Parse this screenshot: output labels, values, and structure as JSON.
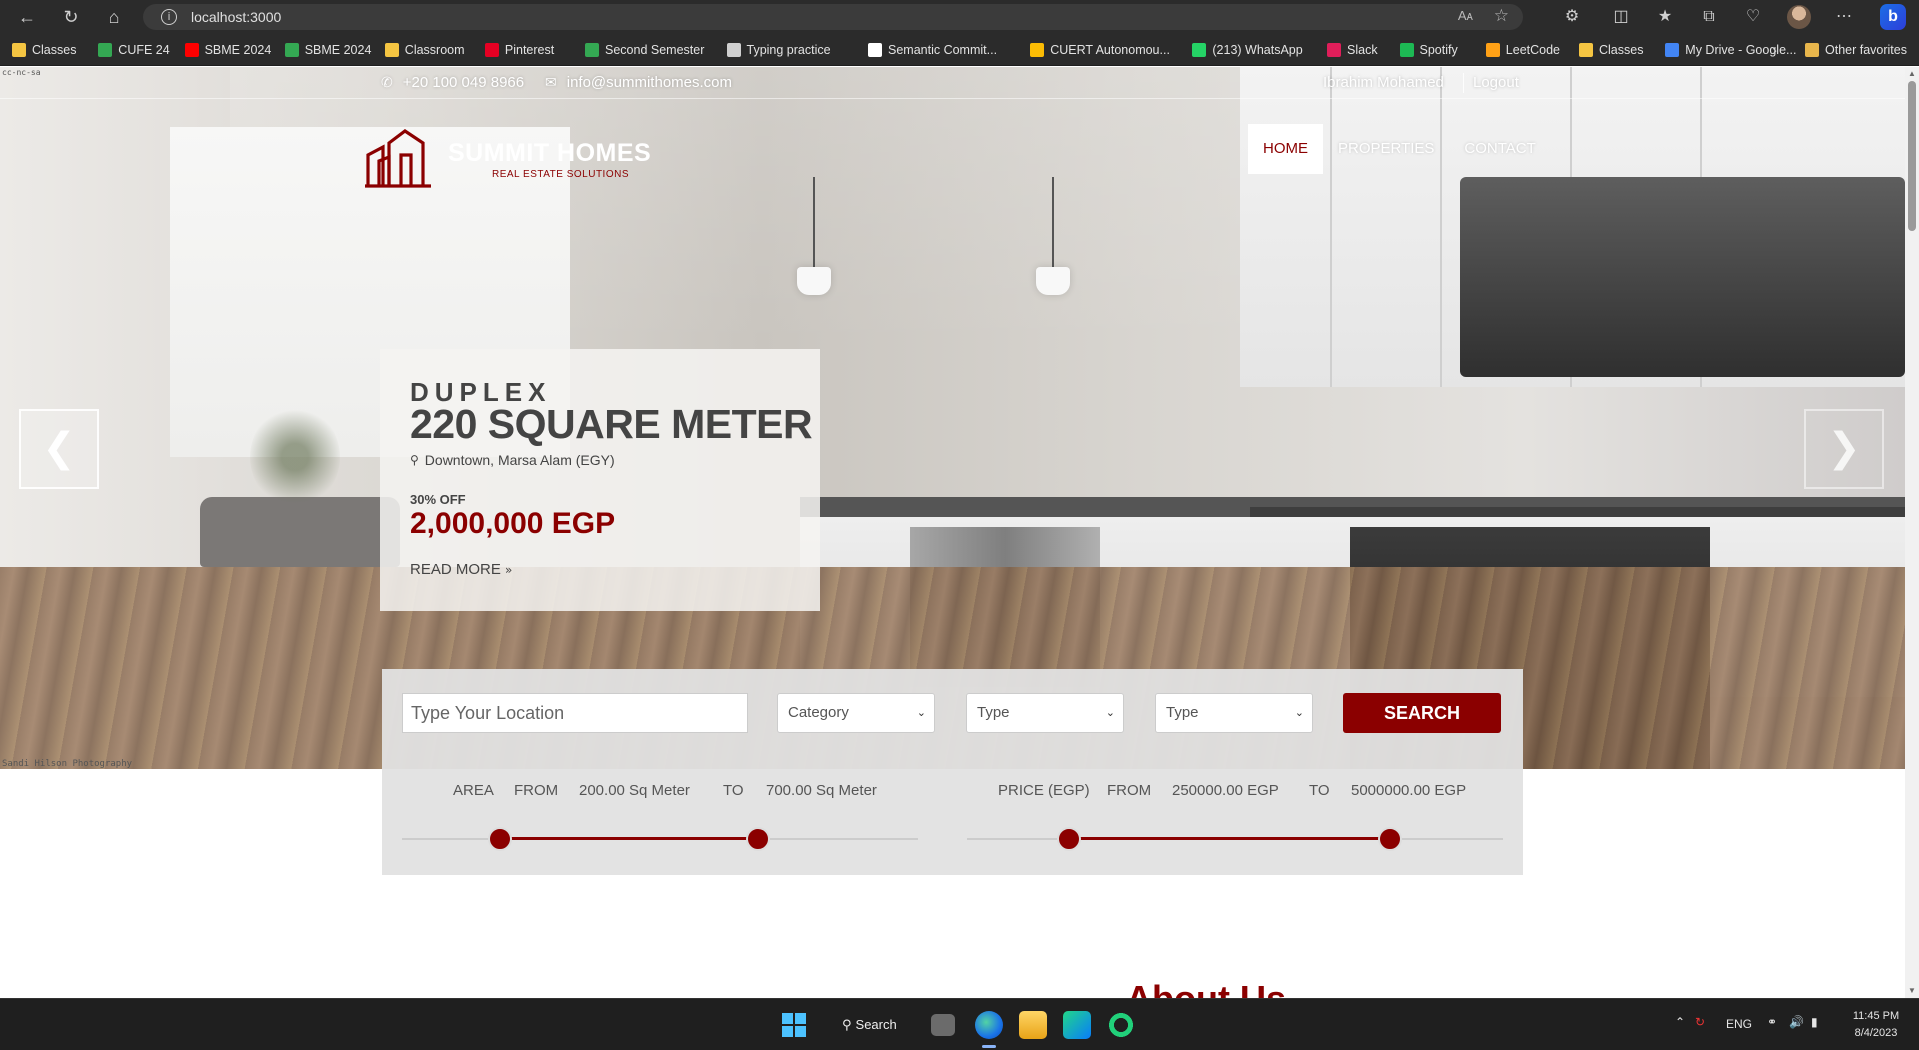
{
  "browser": {
    "url": "localhost:3000",
    "read_aloud": "Aᴀ",
    "bookmarks": [
      {
        "label": "Classes",
        "color": "#f5c542"
      },
      {
        "label": "CUFE 24",
        "color": "#34a853"
      },
      {
        "label": "SBME 2024",
        "color": "#ff0000"
      },
      {
        "label": "SBME 2024",
        "color": "#34a853"
      },
      {
        "label": "Classroom",
        "color": "#f5c542"
      },
      {
        "label": "Pinterest",
        "color": "#e60023"
      },
      {
        "label": "Second Semester",
        "color": "#34a853"
      },
      {
        "label": "Typing practice",
        "color": "#d0d0d0"
      },
      {
        "label": "Semantic Commit...",
        "color": "#ffffff"
      },
      {
        "label": "CUERT Autonomou...",
        "color": "#fbbc04"
      },
      {
        "label": "(213) WhatsApp",
        "color": "#25d366"
      },
      {
        "label": "Slack",
        "color": "#e01e5a"
      },
      {
        "label": "Spotify",
        "color": "#1db954"
      },
      {
        "label": "LeetCode",
        "color": "#ffa116"
      },
      {
        "label": "Classes",
        "color": "#f5c542"
      },
      {
        "label": "My Drive - Google...",
        "color": "#4285f4"
      }
    ],
    "other_favorites": "Other favorites"
  },
  "site": {
    "topbar": {
      "phone": "+20 100 049 8966",
      "email": "info@summithomes.com",
      "user": "Ibrahim Mohamed",
      "logout": "Logout"
    },
    "logo": {
      "brand": "SUMMIT HOMES",
      "tagline": "REAL ESTATE SOLUTIONS"
    },
    "nav": [
      {
        "label": "HOME",
        "active": true
      },
      {
        "label": "PROPERTIES",
        "active": false
      },
      {
        "label": "CONTACT",
        "active": false
      }
    ],
    "slide": {
      "category": "DUPLEX",
      "title": "220 SQUARE METER",
      "location": "Downtown, Marsa Alam (EGY)",
      "discount": "30% OFF",
      "price": "2,000,000 EGP",
      "read_more": "READ MORE"
    },
    "photo_credit_top": "cc-nc-sa",
    "photo_credit_bottom": "Sandi Hilson Photography",
    "search": {
      "location_placeholder": "Type Your Location",
      "selects": [
        "Category",
        "Type",
        "Type"
      ],
      "button": "SEARCH"
    },
    "area_filter": {
      "label": "AREA",
      "from_label": "FROM",
      "from": "200.00 Sq Meter",
      "to_label": "TO",
      "to": "700.00 Sq Meter",
      "low_fraction": 0.19,
      "high_fraction": 0.69
    },
    "price_filter": {
      "label": "PRICE (EGP)",
      "from_label": "FROM",
      "from": "250000.00 EGP",
      "to_label": "TO",
      "to": "5000000.00 EGP",
      "low_fraction": 0.19,
      "high_fraction": 0.79
    },
    "about_heading": "About Us",
    "accent_color": "#8b0000"
  },
  "taskbar": {
    "search": "Search",
    "lang": "ENG",
    "time": "11:45 PM",
    "date": "8/4/2023"
  }
}
